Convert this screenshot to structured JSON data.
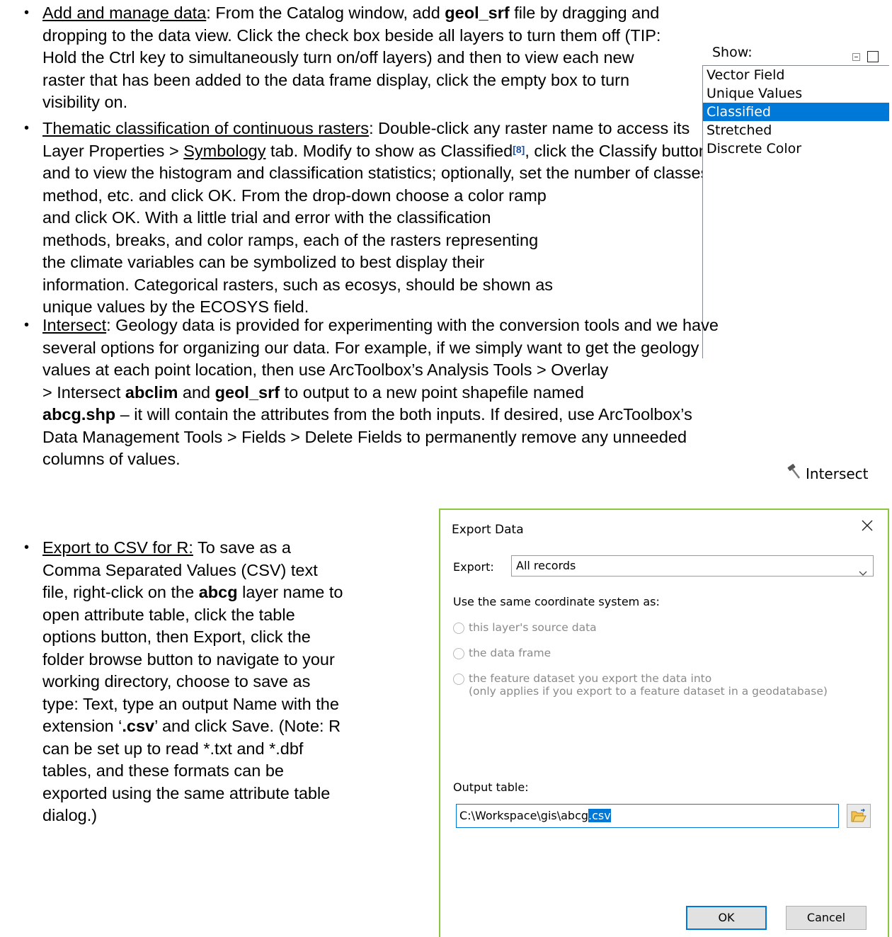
{
  "bullet_glyph": "•",
  "b1": {
    "l1a": "Add and manage data",
    "l1b": ": From the Catalog window, add ",
    "l1c": "geol_srf",
    "l1d": " file by dragging and",
    "l2": "dropping to the data view. Click the check box beside all layers to turn them off (TIP:",
    "l3": "Hold the Ctrl key to simultaneously turn on/off layers) and then to view each new",
    "l4": "raster that has been added to the data frame display, click the empty box to turn",
    "l5": "visibility on."
  },
  "b2": {
    "l1a": "Thematic classification of continuous rasters",
    "l1b": ": Double-click any raster name to access its",
    "l2a": "Layer Properties > ",
    "l2b": "Symbology",
    "l2c": " tab. Modify to show as Classified",
    "l2d": "[8]",
    "l2e": ", click the Classify button",
    "l3": "and to view the histogram and classification statistics; optionally, set the number of classes,",
    "l4": "method, etc. and click OK. From the drop-down choose a color ramp",
    "l5": "and click OK. With a little trial and error with the classification",
    "l6": "methods, breaks, and color ramps, each of the rasters representing",
    "l7": "the climate variables can be symbolized to best display their",
    "l8": "information. Categorical rasters, such as ecosys, should be shown as",
    "l9": "unique values by the ECOSYS field."
  },
  "show_widget": {
    "label": "Show:",
    "items": [
      "Vector Field",
      "Unique Values",
      "Classified",
      "Stretched",
      "Discrete Color"
    ],
    "selected": "Classified"
  },
  "b3": {
    "l1a": "Intersect",
    "l1b": ": Geology data is provided for experimenting with the conversion tools and we have",
    "l2": "several options for organizing our data. For example, if we simply want to get the geology",
    "l3": "values at each point location, then use ArcToolbox’s Analysis Tools > Overlay",
    "l4a": "> Intersect ",
    "l4b": "abclim",
    "l4c": " and ",
    "l4d": "geol_srf",
    "l4e": " to output to a new point shapefile named",
    "l5a": "abcg.shp",
    "l5b": " – it will contain the attributes from the both inputs. If desired, use ArcToolbox’s",
    "l6": "Data Management Tools > Fields > Delete Fields to permanently remove any unneeded",
    "l7": "columns of values."
  },
  "tool": {
    "label": "Intersect",
    "icon": "hammer-icon"
  },
  "b4": {
    "l1a": "Export to CSV for R:",
    "l1b": " To save as a",
    "l2": "Comma Separated Values (CSV) text",
    "l3a": "file, right-click on the ",
    "l3b": "abcg",
    "l3c": " layer name to",
    "l4": "open attribute table, click the table",
    "l5": "options button, then Export, click the",
    "l6": "folder browse button to navigate to your",
    "l7": "working directory, choose to save as",
    "l8": "type: Text, type an output Name with the",
    "l9a": "extension ‘",
    "l9b": ".csv",
    "l9c": "’ and click Save. (Note: R",
    "l10": "can be set up to read *.txt and *.dbf",
    "l11": "tables, and these formats can be",
    "l12": "exported using the same attribute table",
    "l13": "dialog.)"
  },
  "dialog": {
    "title": "Export Data",
    "export_label": "Export:",
    "export_value": "All records",
    "coord_label": "Use the same coordinate system as:",
    "radio1": "this layer's source data",
    "radio2": "the data frame",
    "radio3a": "the feature dataset you export the data into",
    "radio3b": "(only applies if you export to a feature dataset in a geodatabase)",
    "output_label": "Output table:",
    "output_prefix": "C:\\Workspace\\gis\\abcg",
    "output_selected": ".csv",
    "ok": "OK",
    "cancel": "Cancel",
    "accent": "#0078d7",
    "border_color": "#8cc63e"
  }
}
